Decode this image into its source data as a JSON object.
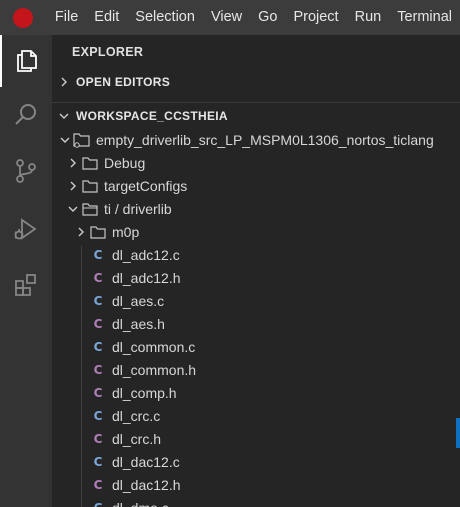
{
  "menubar": {
    "items": [
      "File",
      "Edit",
      "Selection",
      "View",
      "Go",
      "Project",
      "Run",
      "Terminal"
    ]
  },
  "activitybar": {
    "icons": [
      "files-icon",
      "search-icon",
      "source-control-icon",
      "run-debug-icon",
      "extensions-icon"
    ]
  },
  "sidebar": {
    "title": "EXPLORER",
    "open_editors": "OPEN EDITORS",
    "workspace": "WORKSPACE_CCSTHEIA",
    "project": "empty_driverlib_src_LP_MSPM0L1306_nortos_ticlang",
    "folders": {
      "debug": "Debug",
      "targetConfigs": "targetConfigs",
      "ti_driverlib": "ti / driverlib",
      "m0p": "m0p"
    },
    "files": [
      {
        "name": "dl_adc12.c",
        "type": "c"
      },
      {
        "name": "dl_adc12.h",
        "type": "h"
      },
      {
        "name": "dl_aes.c",
        "type": "c"
      },
      {
        "name": "dl_aes.h",
        "type": "h"
      },
      {
        "name": "dl_common.c",
        "type": "c"
      },
      {
        "name": "dl_common.h",
        "type": "h"
      },
      {
        "name": "dl_comp.h",
        "type": "h"
      },
      {
        "name": "dl_crc.c",
        "type": "c"
      },
      {
        "name": "dl_crc.h",
        "type": "h"
      },
      {
        "name": "dl_dac12.c",
        "type": "c"
      },
      {
        "name": "dl_dac12.h",
        "type": "h"
      },
      {
        "name": "dl_dma.c",
        "type": "c"
      }
    ]
  },
  "colors": {
    "accent": "#0e70c0",
    "c_file": "#7aa6da",
    "h_file": "#b07fb8",
    "logo": "#c4141c"
  }
}
